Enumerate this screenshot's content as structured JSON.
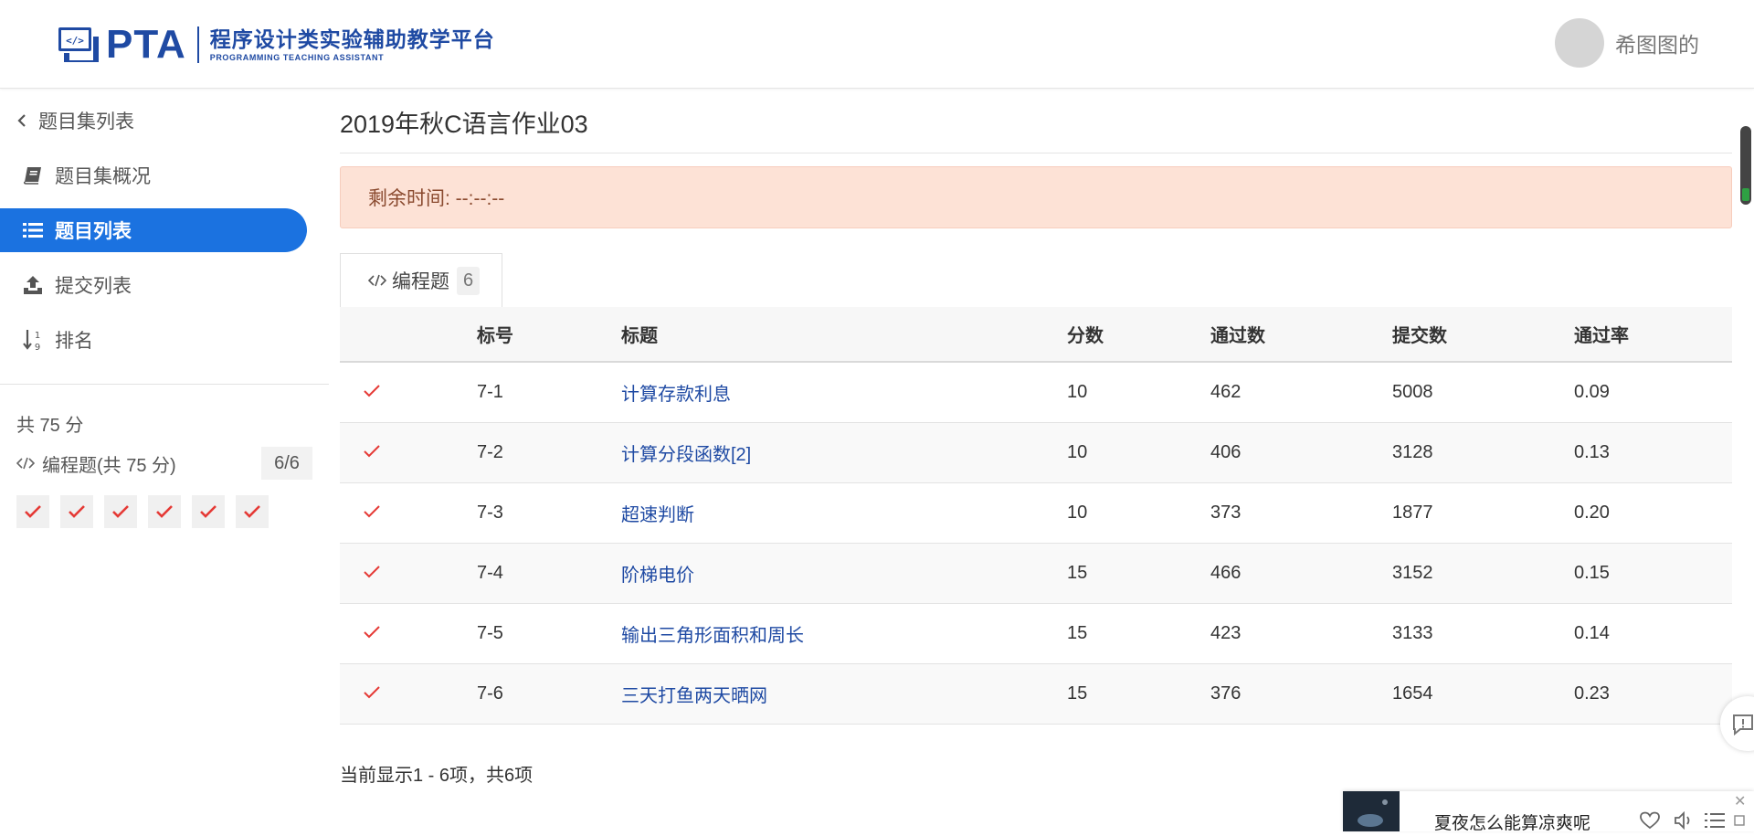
{
  "header": {
    "brand": "PTA",
    "platform_cn": "程序设计类实验辅助教学平台",
    "platform_en": "PROGRAMMING TEACHING ASSISTANT",
    "username": "希图图的"
  },
  "sidebar": {
    "back_label": "题目集列表",
    "items": [
      {
        "label": "题目集概况",
        "icon": "book-icon"
      },
      {
        "label": "题目列表",
        "icon": "list-icon",
        "active": true
      },
      {
        "label": "提交列表",
        "icon": "upload-icon"
      },
      {
        "label": "排名",
        "icon": "sort-numeric-icon"
      }
    ],
    "total_score": "共 75 分",
    "programming_label": "编程题(共 75 分)",
    "programming_count": "6/6"
  },
  "main": {
    "title": "2019年秋C语言作业03",
    "timer_text": "剩余时间: --:--:--",
    "tab": {
      "label": "编程题",
      "count": "6"
    },
    "table": {
      "headers": [
        "",
        "标号",
        "标题",
        "分数",
        "通过数",
        "提交数",
        "通过率"
      ],
      "rows": [
        {
          "id": "7-1",
          "title": "计算存款利息",
          "score": "10",
          "passed": "462",
          "submitted": "5008",
          "rate": "0.09"
        },
        {
          "id": "7-2",
          "title": "计算分段函数[2]",
          "score": "10",
          "passed": "406",
          "submitted": "3128",
          "rate": "0.13"
        },
        {
          "id": "7-3",
          "title": "超速判断",
          "score": "10",
          "passed": "373",
          "submitted": "1877",
          "rate": "0.20"
        },
        {
          "id": "7-4",
          "title": "阶梯电价",
          "score": "15",
          "passed": "466",
          "submitted": "3152",
          "rate": "0.15"
        },
        {
          "id": "7-5",
          "title": "输出三角形面积和周长",
          "score": "15",
          "passed": "423",
          "submitted": "3133",
          "rate": "0.14"
        },
        {
          "id": "7-6",
          "title": "三天打鱼两天晒网",
          "score": "15",
          "passed": "376",
          "submitted": "1654",
          "rate": "0.23"
        }
      ]
    },
    "paging_text": "当前显示1 - 6项，共6项"
  },
  "player": {
    "song": "夏夜怎么能算凉爽呢"
  },
  "colors": {
    "brand": "#1f4aa3",
    "active_nav": "#1b72e0",
    "check": "#e53935",
    "timer_bg": "#fde2d6"
  }
}
